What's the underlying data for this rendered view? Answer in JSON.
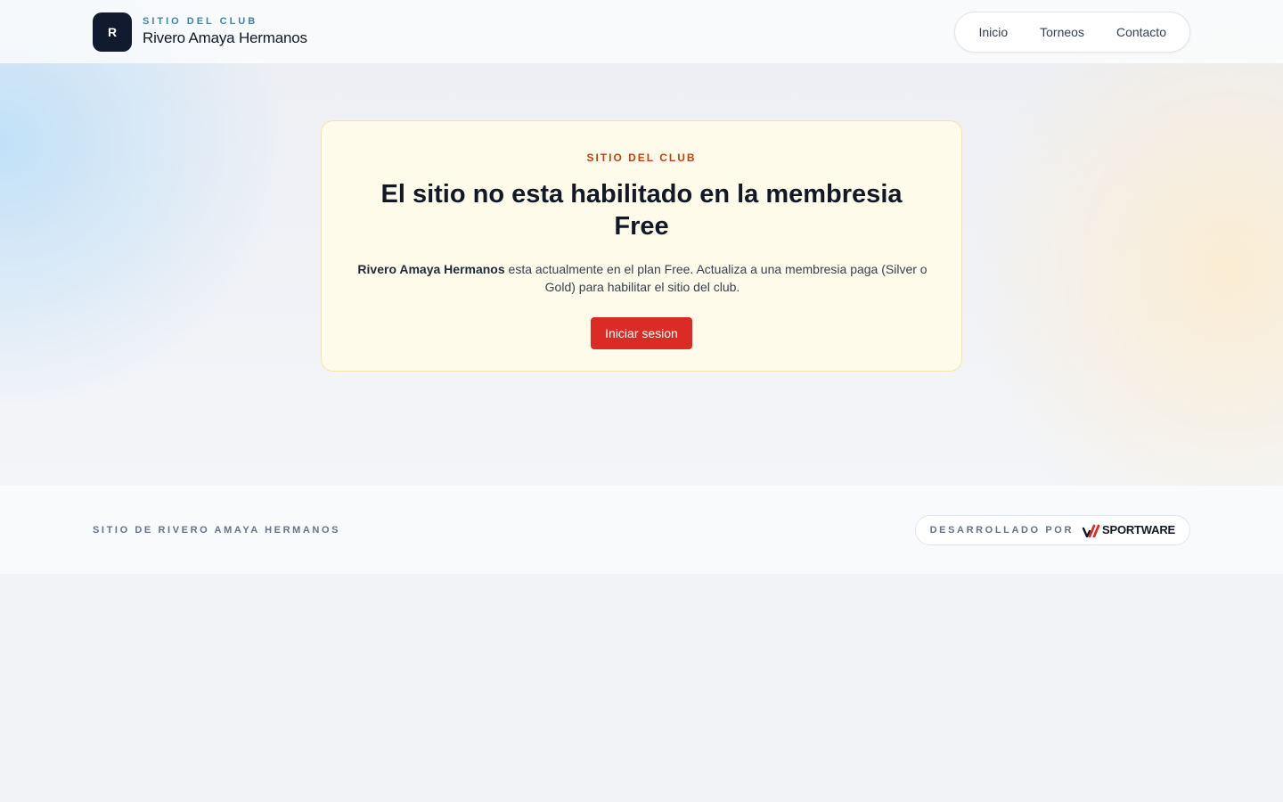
{
  "header": {
    "logo_letter": "R",
    "kicker": "SITIO DEL CLUB",
    "club_name": "Rivero Amaya Hermanos",
    "nav": [
      {
        "label": "Inicio"
      },
      {
        "label": "Torneos"
      },
      {
        "label": "Contacto"
      }
    ]
  },
  "notice": {
    "kicker": "SITIO DEL CLUB",
    "title": "El sitio no esta habilitado en la membresia Free",
    "club_name": "Rivero Amaya Hermanos",
    "body": " esta actualmente en el plan Free. Actualiza a una membresia paga (Silver o Gold) para habilitar el sitio del club.",
    "button_label": "Iniciar sesion"
  },
  "footer": {
    "site_label": "SITIO DE RIVERO AMAYA HERMANOS",
    "developed_by": "DESARROLLADO POR",
    "brand": "SPORTWARE"
  },
  "colors": {
    "accent": "#dc2b25",
    "kicker_blue": "#3b86b0",
    "kicker_orange": "#c2410c",
    "card_bg": "#fffbea",
    "logo_bg": "#111a2e"
  },
  "icons": {
    "brand_logo": "club-initial-logo",
    "developer_logo": "sportware-logo"
  }
}
